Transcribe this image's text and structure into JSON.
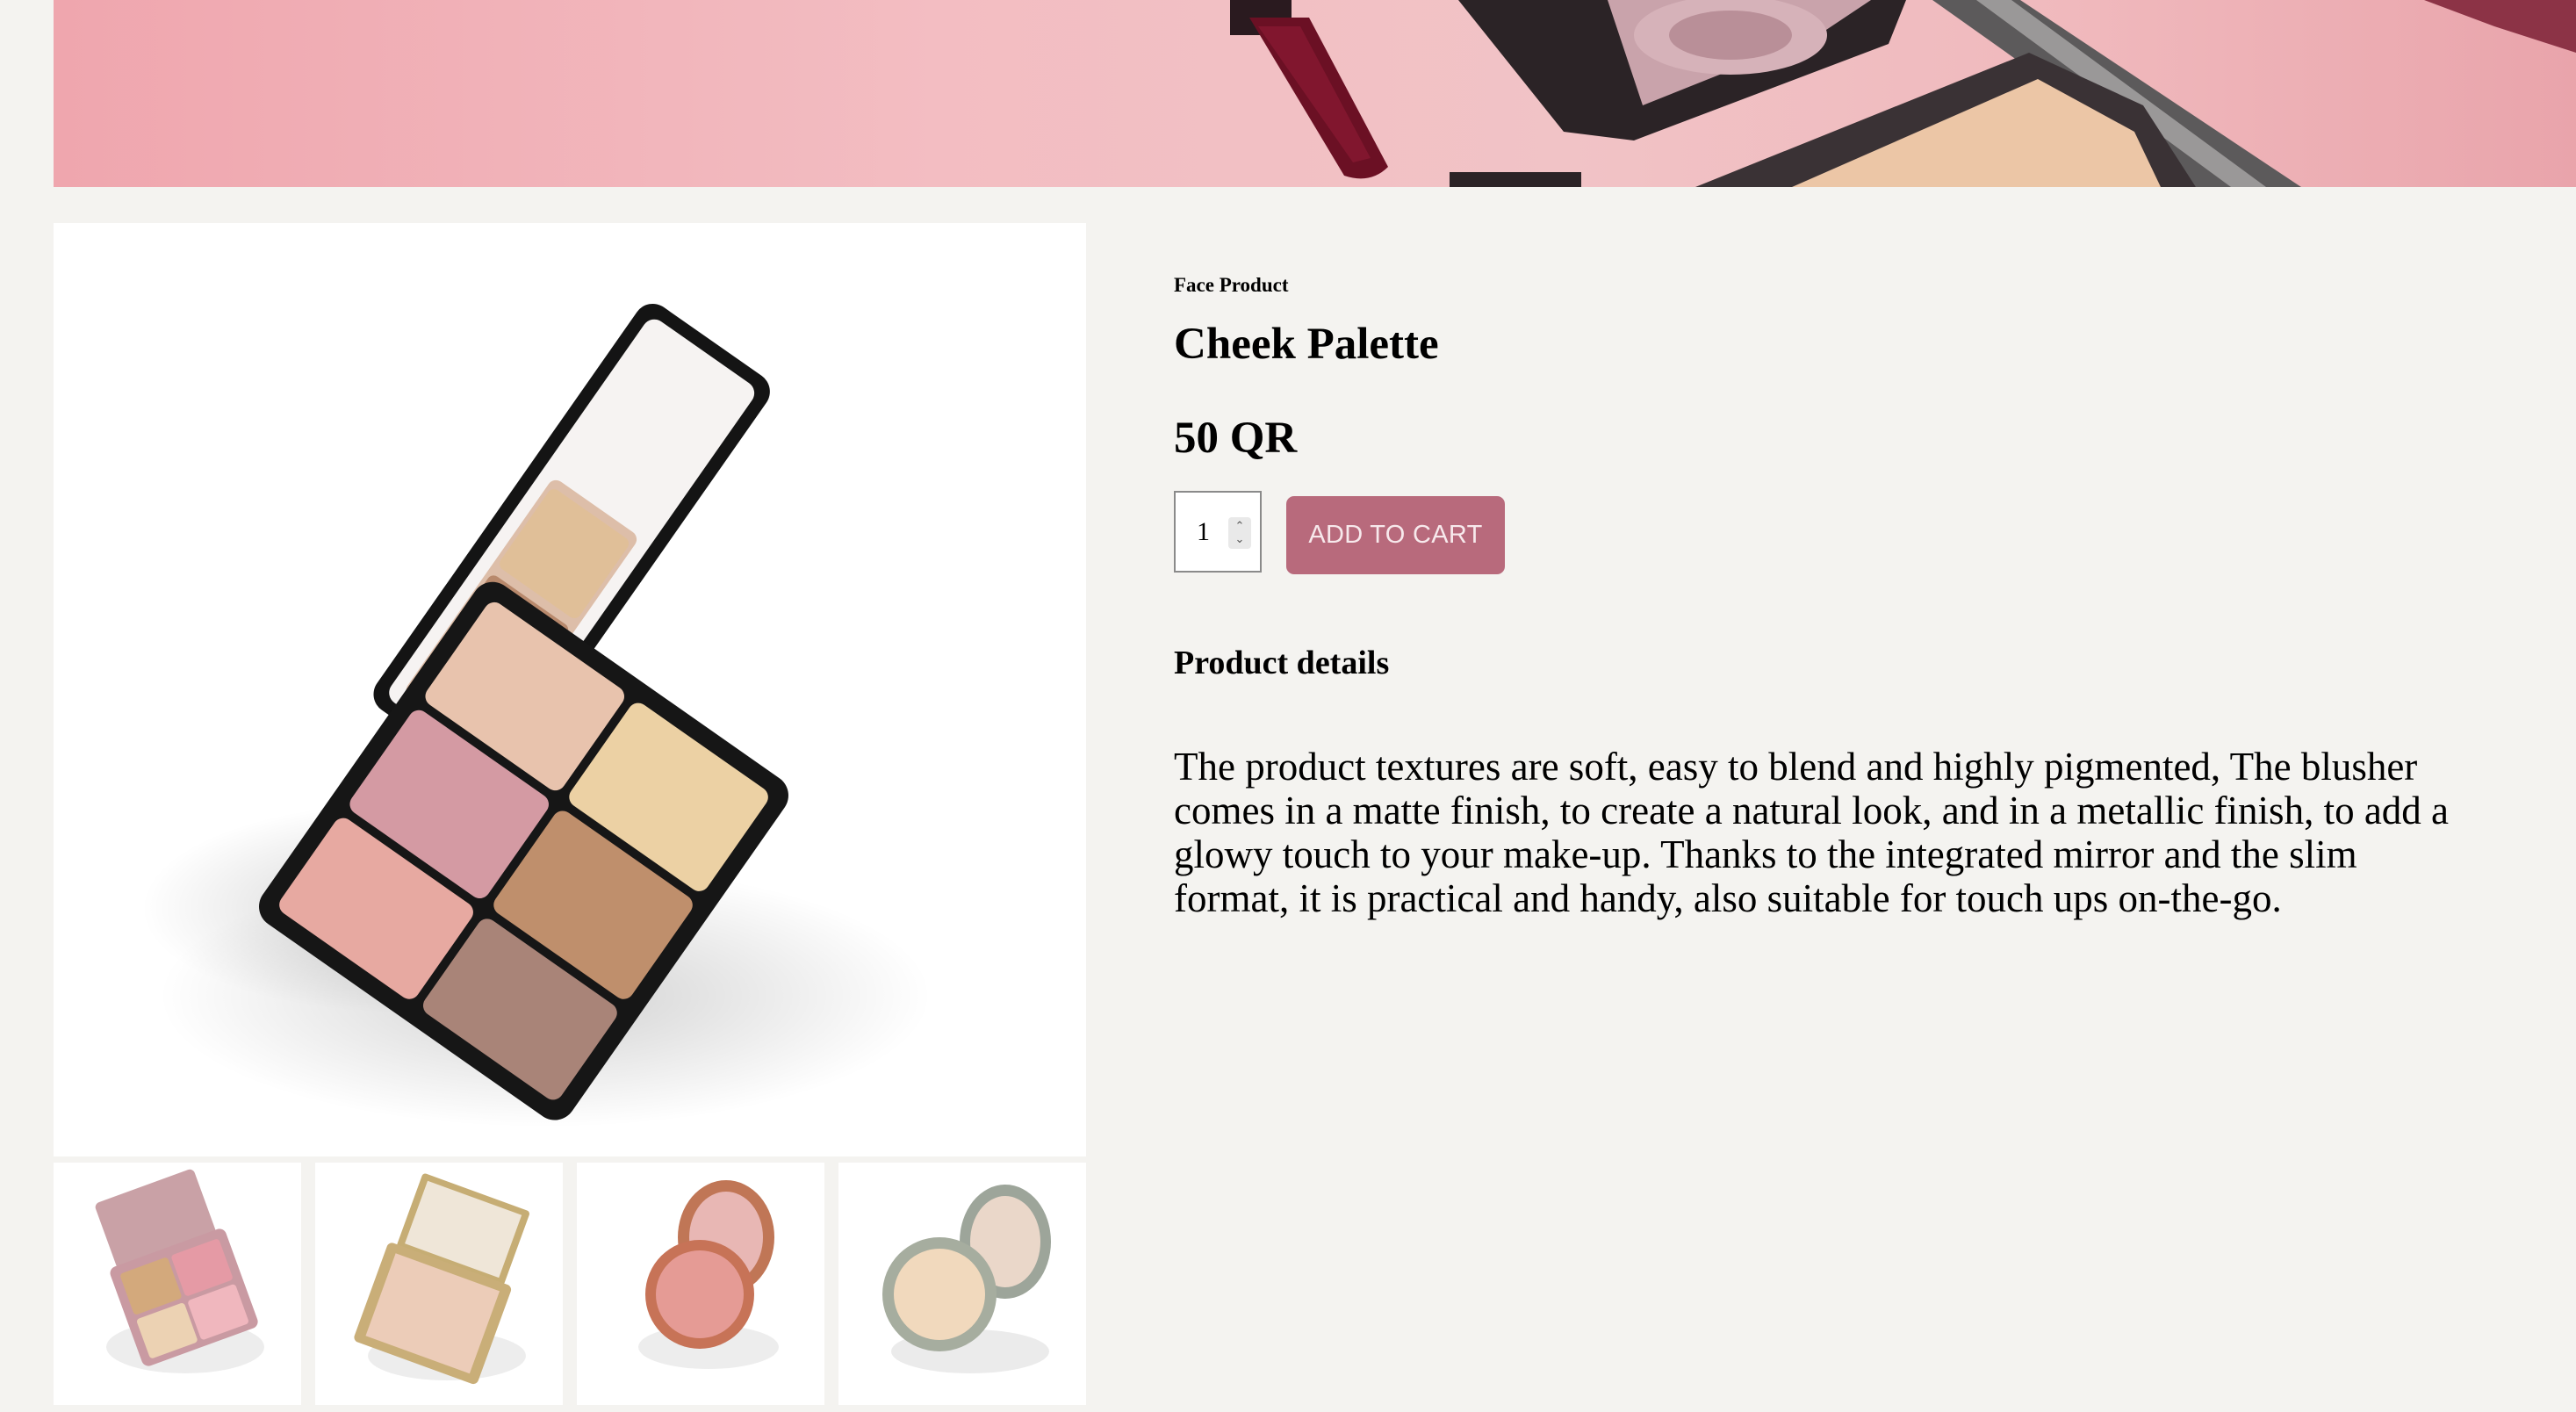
{
  "product": {
    "category": "Face Product",
    "title": "Cheek Palette",
    "price": "50 QR",
    "quantity": "1",
    "add_to_cart_label": "ADD TO CART",
    "details_heading": "Product details",
    "description": "The product textures are soft, easy to blend and highly pigmented, The blusher comes in a matte finish, to create a natural look, and in a metallic finish, to add a glowy touch to your make-up. Thanks to the integrated mirror and the slim format, it is practical and handy, also suitable for touch ups on-the-go."
  },
  "colors": {
    "page_background": "#f4f3f0",
    "accent_button": "#b86a7c",
    "hero_pink": "#f3bdc2"
  },
  "icons": {
    "quantity_stepper": "spinner-arrows-icon"
  }
}
